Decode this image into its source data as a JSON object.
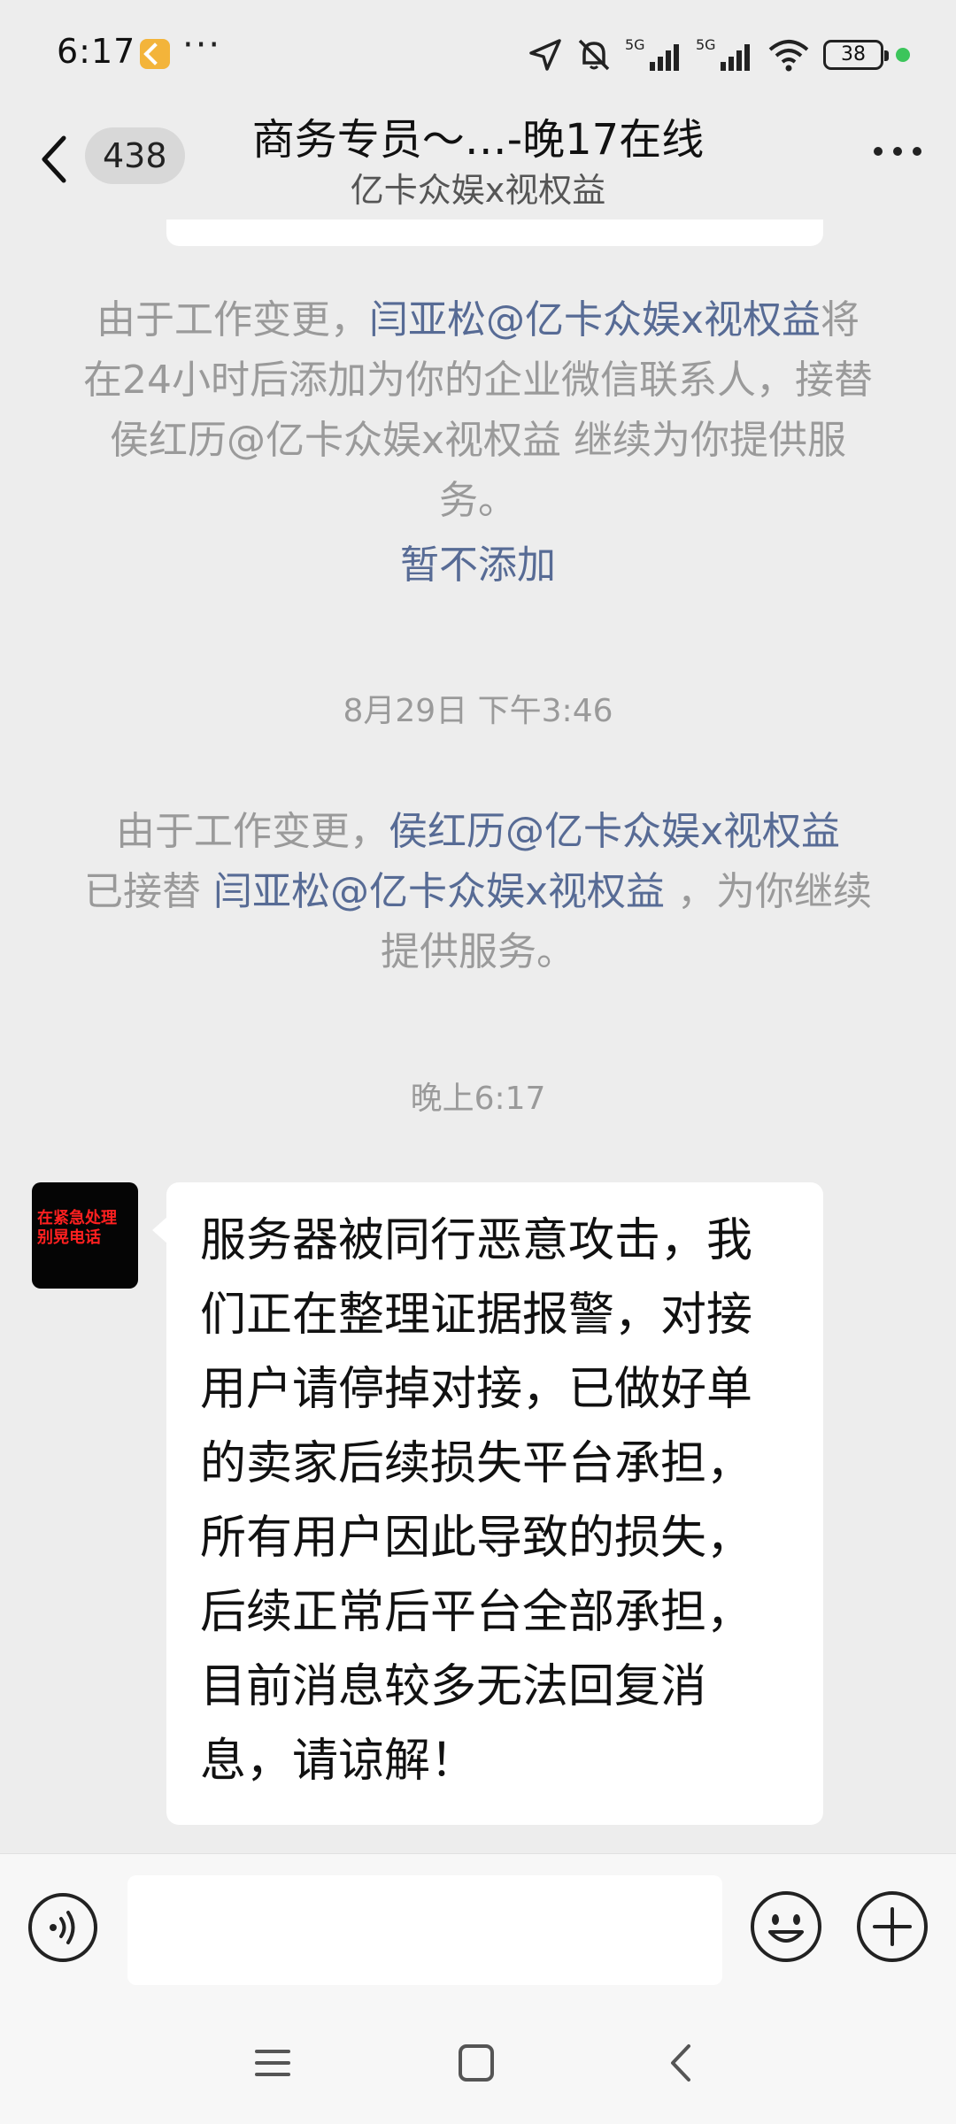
{
  "status_bar": {
    "time": "6:17",
    "overflow": "···",
    "network1": "5G",
    "network2": "5G",
    "battery": "38"
  },
  "header": {
    "unread_count": "438",
    "title": "商务专员～…-晚17在线",
    "subtitle": "亿卡众娱x视权益"
  },
  "messages": {
    "notice1": {
      "prefix": "由于工作变更，",
      "link1": "闫亚松@亿卡众娱x视权益",
      "middle": "将在24小时后添加为你的企业微信联系人，接替 侯红历@亿卡众娱x视权益 继续为你提供服务。"
    },
    "notice1_action": "暂不添加",
    "timestamp1": "8月29日 下午3:46",
    "notice2": {
      "prefix": "由于工作变更，",
      "link1": "侯红历@亿卡众娱x视权益",
      "middle": "已接替 ",
      "link2": "闫亚松@亿卡众娱x视权益",
      "suffix": " ，为你继续提供服务。"
    },
    "timestamp2": "晚上6:17",
    "avatar_text": "在紧急处理 别晃电话",
    "bubble_text": "服务器被同行恶意攻击，我们正在整理证据报警，对接用户请停掉对接，已做好单的卖家后续损失平台承担，所有用户因此导致的损失，后续正常后平台全部承担，目前消息较多无法回复消息，请谅解！"
  },
  "input": {
    "value": ""
  },
  "colors": {
    "background": "#ededed",
    "link": "#576b95",
    "system_text": "#9a9a9a",
    "bubble": "#ffffff"
  },
  "icons": {
    "voice": "voice-icon",
    "emoji": "emoji-icon",
    "plus": "plus-icon",
    "back": "back-arrow-icon",
    "more": "more-icon"
  }
}
